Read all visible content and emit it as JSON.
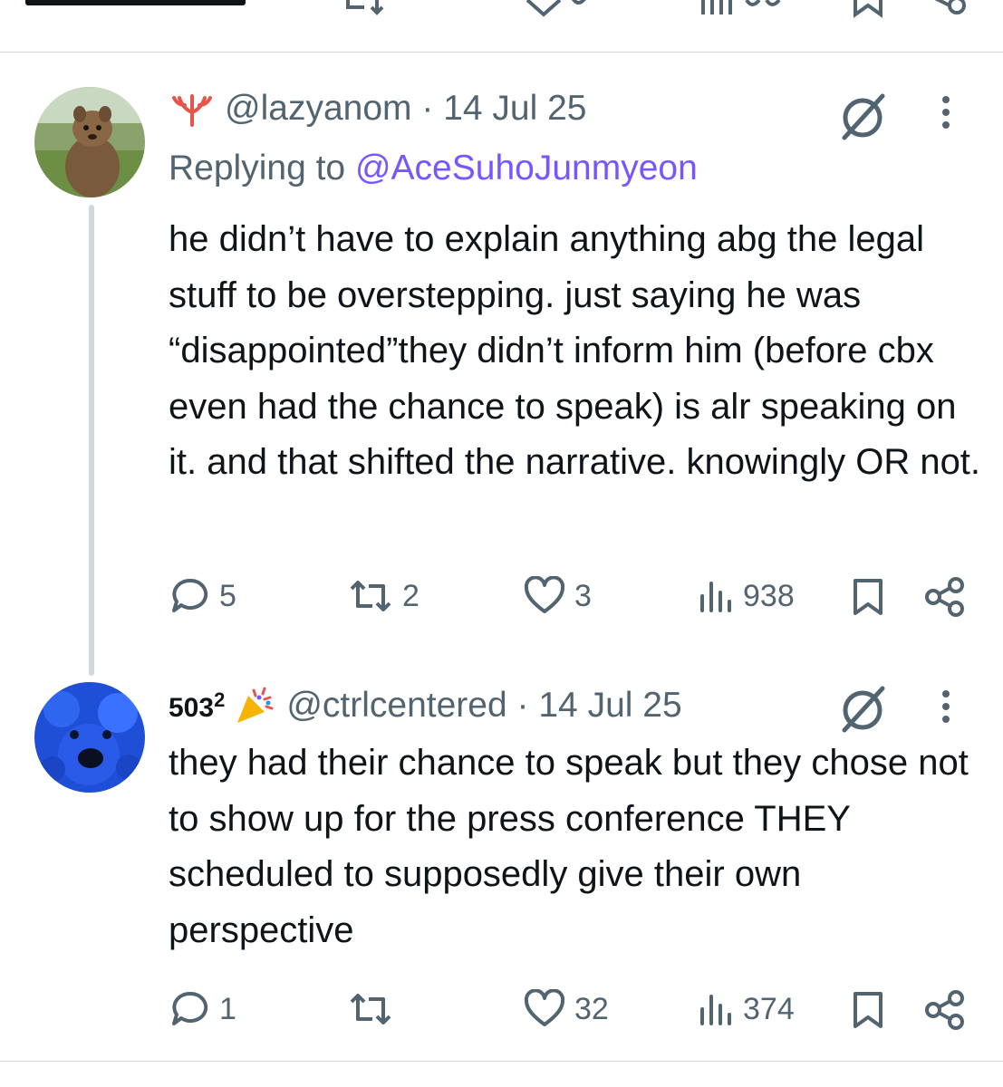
{
  "colors": {
    "text": "#0f1419",
    "muted": "#536471",
    "mention": "#7856ff",
    "divider": "#d4d8dc"
  },
  "tweets": [
    {
      "handle": "@lazyanom",
      "sep": "·",
      "date": "14 Jul 25",
      "badge_icon": "coral-icon",
      "replying_prefix": "Replying to ",
      "replying_to": "@AceSuhoJunmyeon",
      "text": "he didn’t have to explain anything abg the legal stuff to be overstepping. just saying he was “disappointed”they didn’t inform him (before cbx even had the chance to speak) is alr speaking on it. and that shifted the narrative. knowingly OR not.",
      "replies": "5",
      "retweets": "2",
      "likes": "3",
      "views": "938"
    },
    {
      "display_name": "503",
      "display_sup": "2",
      "badge_icon": "party-popper-icon",
      "handle": "@ctrlcentered",
      "sep": "·",
      "date": "14 Jul 25",
      "text": "they had their chance to speak but they chose not to show up for the press conference THEY scheduled to supposedly give their own perspective",
      "replies": "1",
      "retweets": "",
      "likes": "32",
      "views": "374"
    }
  ]
}
